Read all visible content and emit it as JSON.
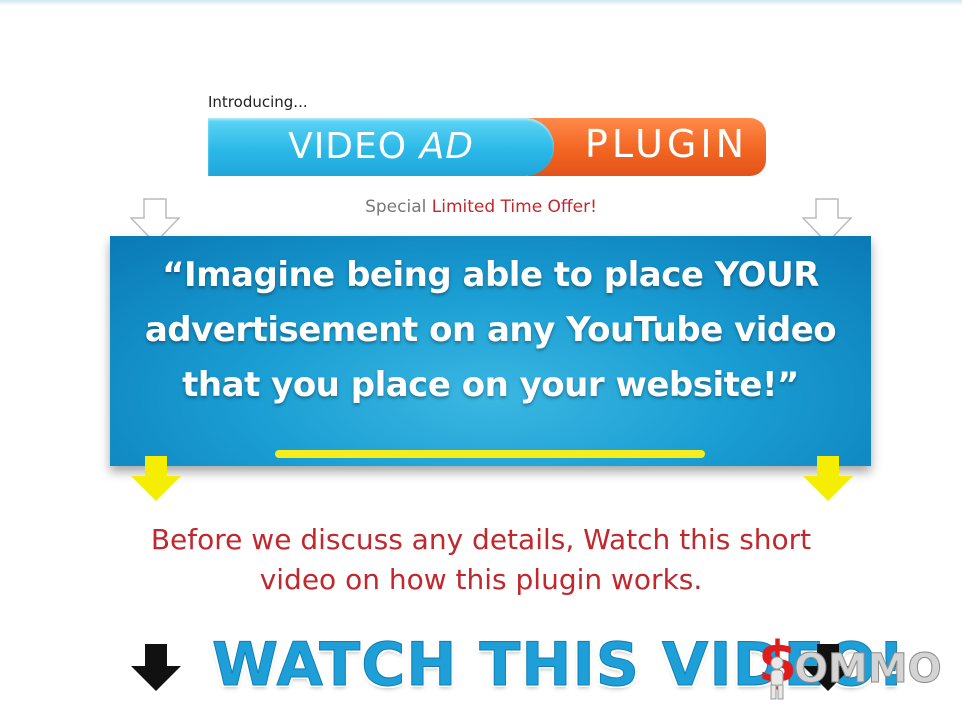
{
  "header": {
    "introducing": "Introducing..."
  },
  "logo": {
    "video": "VIDEO ",
    "ad": "AD",
    "plugin": "PLUGIN"
  },
  "offer": {
    "special": "Special",
    "limited": "Limited Time Offer!"
  },
  "banner": {
    "quote": "“Imagine being able to place YOUR advertisement on any YouTube video that you place on your website!”"
  },
  "details": {
    "text": "Before we discuss any details, Watch this short video on how this plugin works."
  },
  "watch": {
    "text": "WATCH THIS VIDEO!"
  },
  "watermark": {
    "dollar": "$",
    "text": "OMMO"
  },
  "colors": {
    "blue": "#1e9fd8",
    "orange": "#f26522",
    "red": "#c0282d",
    "yellow": "#f5ee1a"
  }
}
